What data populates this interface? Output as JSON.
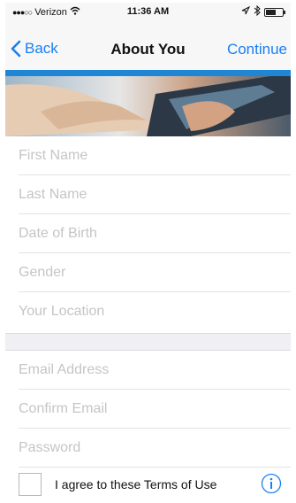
{
  "status_bar": {
    "signal": "●●●○○",
    "carrier": "Verizon",
    "time": "11:36 AM",
    "battery_level": 0.6
  },
  "nav": {
    "back_label": "Back",
    "title": "About You",
    "continue_label": "Continue"
  },
  "form": {
    "personal": [
      {
        "placeholder": "First Name",
        "value": ""
      },
      {
        "placeholder": "Last Name",
        "value": ""
      },
      {
        "placeholder": "Date of Birth",
        "value": ""
      },
      {
        "placeholder": "Gender",
        "value": ""
      },
      {
        "placeholder": "Your Location",
        "value": ""
      }
    ],
    "account": [
      {
        "placeholder": "Email Address",
        "value": ""
      },
      {
        "placeholder": "Confirm Email",
        "value": ""
      },
      {
        "placeholder": "Password",
        "value": ""
      }
    ],
    "terms_label": "I agree to these Terms of Use",
    "terms_checked": false
  },
  "colors": {
    "accent": "#1a7ff0",
    "stripe": "#1f86d6"
  },
  "icons": [
    "back-chevron-icon",
    "wifi-icon",
    "location-arrow-icon",
    "bluetooth-icon",
    "battery-icon",
    "info-icon"
  ]
}
